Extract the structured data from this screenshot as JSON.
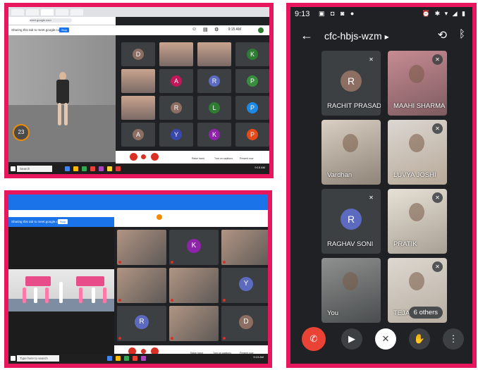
{
  "panel1": {
    "share_text": "Sharing this tab to meet.google.com",
    "stop_label": "Stop",
    "address_url": "meet.google.com",
    "timer_value": "23",
    "clock": "9:15 AM",
    "tiles": [
      {
        "letter": "D",
        "color": "#8d6e63",
        "type": "avatar"
      },
      {
        "letter": "",
        "type": "photo"
      },
      {
        "letter": "",
        "type": "photo"
      },
      {
        "letter": "K",
        "color": "#2e7d32",
        "type": "avatar"
      },
      {
        "letter": "",
        "type": "photo"
      },
      {
        "letter": "A",
        "color": "#c2185b",
        "type": "avatar"
      },
      {
        "letter": "R",
        "color": "#5c6bc0",
        "type": "avatar"
      },
      {
        "letter": "P",
        "color": "#388e3c",
        "type": "avatar"
      },
      {
        "letter": "",
        "type": "photo"
      },
      {
        "letter": "R",
        "color": "#8d6e63",
        "type": "avatar"
      },
      {
        "letter": "L",
        "color": "#2e7d32",
        "type": "avatar"
      },
      {
        "letter": "P",
        "color": "#1e88e5",
        "type": "avatar"
      },
      {
        "letter": "A",
        "color": "#8d6e63",
        "type": "avatar"
      },
      {
        "letter": "Y",
        "color": "#3949ab",
        "type": "avatar"
      },
      {
        "letter": "K",
        "color": "#8e24aa",
        "type": "avatar"
      },
      {
        "letter": "P",
        "color": "#e64a19",
        "type": "avatar"
      }
    ],
    "controls": [
      "Raise hand",
      "Turn on captions",
      "Present now"
    ],
    "search_label": "Search",
    "taskbar_clock": "9:15 AM"
  },
  "panel2": {
    "share_text": "Sharing this tab to meet.google.com",
    "stop_label": "Stop",
    "tiles": [
      {
        "letter": "",
        "type": "photo"
      },
      {
        "letter": "K",
        "color": "#8e24aa",
        "type": "avatar"
      },
      {
        "letter": "",
        "type": "photo"
      },
      {
        "letter": "",
        "type": "photo"
      },
      {
        "letter": "",
        "type": "photo"
      },
      {
        "letter": "Y",
        "color": "#5c6bc0",
        "type": "avatar"
      },
      {
        "letter": "R",
        "color": "#5c6bc0",
        "type": "avatar"
      },
      {
        "letter": "",
        "type": "photo"
      },
      {
        "letter": "D",
        "color": "#8d6e63",
        "type": "avatar"
      }
    ],
    "controls": [
      "Raise hand",
      "Turn on captions",
      "Present now"
    ],
    "search_label": "Type here to search",
    "taskbar_clock": "9:15 AM"
  },
  "phone": {
    "time": "9:13",
    "meeting_code": "cfc-hbjs-wzm",
    "participants": [
      {
        "name": "RACHIT PRASAD",
        "letter": "R",
        "color": "#8d6e63",
        "type": "avatar",
        "muted": true
      },
      {
        "name": "MAAHI SHARMA",
        "letter": "",
        "type": "photo1",
        "muted": true
      },
      {
        "name": "Vardhan",
        "letter": "",
        "type": "photo2",
        "muted": false
      },
      {
        "name": "LUVYA JOSHI",
        "letter": "",
        "type": "photo3",
        "muted": true
      },
      {
        "name": "RAGHAV SONI",
        "letter": "R",
        "color": "#5c6bc0",
        "type": "avatar",
        "muted": true
      },
      {
        "name": "PRATIK",
        "letter": "",
        "type": "photo4",
        "muted": true
      },
      {
        "name": "You",
        "letter": "",
        "type": "photo5",
        "muted": false
      },
      {
        "name": "TEJA",
        "letter": "",
        "type": "photo6",
        "muted": true
      }
    ],
    "others_label": "6 others"
  }
}
